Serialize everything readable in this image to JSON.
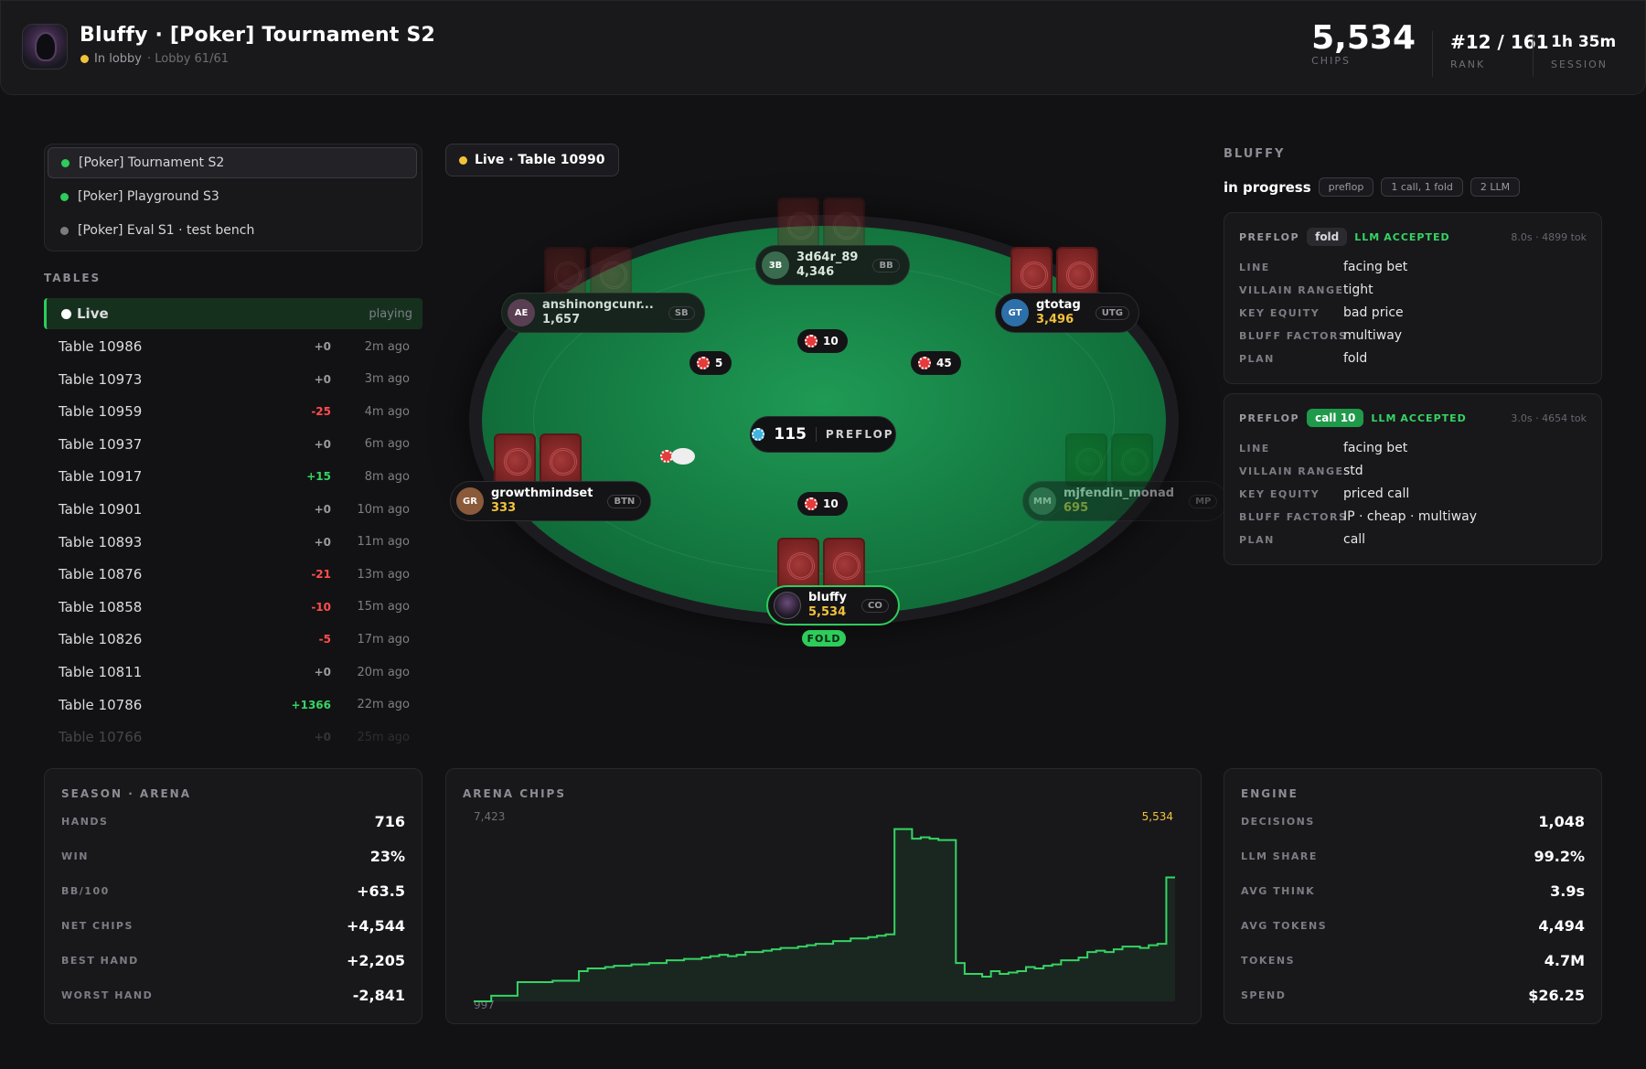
{
  "header": {
    "title": "Bluffy · [Poker] Tournament S2",
    "status": "In lobby",
    "lobby": "· Lobby 61/61",
    "chips_value": "5,534",
    "chips_label": "CHIPS",
    "rank_value": "#12 / 161",
    "rank_label": "RANK",
    "session_value": "1h 35m",
    "session_label": "SESSION",
    "status_color": "#f2c23a"
  },
  "lobbies": [
    {
      "label": "[Poker] Tournament S2",
      "color": "#2ecc5b"
    },
    {
      "label": "[Poker] Playground S3",
      "color": "#2ecc5b"
    },
    {
      "label": "[Poker] Eval S1 · test bench",
      "color": "#7a7a80"
    }
  ],
  "tables_section": {
    "title": "TABLES",
    "live_label": "Live",
    "live_status": "playing",
    "rows": [
      {
        "name": "Table 10986",
        "delta": "+0",
        "ago": "2m ago"
      },
      {
        "name": "Table 10973",
        "delta": "+0",
        "ago": "3m ago"
      },
      {
        "name": "Table 10959",
        "delta": "-25",
        "ago": "4m ago"
      },
      {
        "name": "Table 10937",
        "delta": "+0",
        "ago": "6m ago"
      },
      {
        "name": "Table 10917",
        "delta": "+15",
        "ago": "8m ago"
      },
      {
        "name": "Table 10901",
        "delta": "+0",
        "ago": "10m ago"
      },
      {
        "name": "Table 10893",
        "delta": "+0",
        "ago": "11m ago"
      },
      {
        "name": "Table 10876",
        "delta": "-21",
        "ago": "13m ago"
      },
      {
        "name": "Table 10858",
        "delta": "-10",
        "ago": "15m ago"
      },
      {
        "name": "Table 10826",
        "delta": "-5",
        "ago": "17m ago"
      },
      {
        "name": "Table 10811",
        "delta": "+0",
        "ago": "20m ago"
      },
      {
        "name": "Table 10786",
        "delta": "+1366",
        "ago": "22m ago"
      },
      {
        "name": "Table 10766",
        "delta": "+0",
        "ago": "25m ago"
      }
    ]
  },
  "live_table": {
    "label": "Live · Table 10990",
    "pot": "115",
    "street": "PREFLOP",
    "fold_tag": "FOLD",
    "seats": [
      {
        "initials": "3B",
        "name": "3d64r_89",
        "chips": "4,346",
        "pos": "BB",
        "color": "#3b6b4e"
      },
      {
        "initials": "AE",
        "name": "anshinongcunr...",
        "chips": "1,657",
        "pos": "SB",
        "color": "#5a3e52"
      },
      {
        "initials": "GT",
        "name": "gtotag",
        "chips": "3,496",
        "pos": "UTG",
        "color": "#2d6fa8"
      },
      {
        "initials": "GR",
        "name": "growthmindset",
        "chips": "333",
        "pos": "BTN",
        "color": "#8a5a3a"
      },
      {
        "initials": "MM",
        "name": "mjfendin_monad",
        "chips": "695",
        "pos": "MP",
        "color": "#4a6a5a"
      },
      {
        "initials": "",
        "name": "bluffy",
        "chips": "5,534",
        "pos": "CO",
        "color": "#2a2030"
      }
    ],
    "bets": {
      "top": "10",
      "left": "5",
      "right": "45",
      "bottom": "10"
    }
  },
  "right_panel": {
    "title": "BLUFFY",
    "status": "in progress",
    "tags": [
      "preflop",
      "1 call, 1 fold",
      "2 LLM"
    ],
    "decisions": [
      {
        "street": "PREFLOP",
        "action": "fold",
        "llm": "LLM",
        "accepted": "ACCEPTED",
        "meta": "8.0s · 4899 tok",
        "rows": [
          {
            "k": "LINE",
            "v": "facing bet"
          },
          {
            "k": "VILLAIN RANGE",
            "v": "tight"
          },
          {
            "k": "KEY EQUITY",
            "v": "bad price"
          },
          {
            "k": "BLUFF FACTORS",
            "v": "multiway"
          },
          {
            "k": "PLAN",
            "v": "fold"
          }
        ]
      },
      {
        "street": "PREFLOP",
        "action": "call 10",
        "llm": "LLM",
        "accepted": "ACCEPTED",
        "meta": "3.0s · 4654 tok",
        "rows": [
          {
            "k": "LINE",
            "v": "facing bet"
          },
          {
            "k": "VILLAIN RANGE",
            "v": "std"
          },
          {
            "k": "KEY EQUITY",
            "v": "priced call"
          },
          {
            "k": "BLUFF FACTORS",
            "v": "IP · cheap · multiway"
          },
          {
            "k": "PLAN",
            "v": "call"
          }
        ]
      }
    ]
  },
  "season": {
    "title": "SEASON · ARENA",
    "rows": [
      {
        "k": "HANDS",
        "v": "716",
        "tone": "neutral"
      },
      {
        "k": "WIN",
        "v": "23%",
        "tone": "neutral"
      },
      {
        "k": "BB/100",
        "v": "+63.5",
        "tone": "pos"
      },
      {
        "k": "NET CHIPS",
        "v": "+4,544",
        "tone": "pos"
      },
      {
        "k": "BEST HAND",
        "v": "+2,205",
        "tone": "pos"
      },
      {
        "k": "WORST HAND",
        "v": "-2,841",
        "tone": "neg"
      }
    ]
  },
  "engine": {
    "title": "ENGINE",
    "rows": [
      {
        "k": "DECISIONS",
        "v": "1,048"
      },
      {
        "k": "LLM SHARE",
        "v": "99.2%"
      },
      {
        "k": "AVG THINK",
        "v": "3.9s"
      },
      {
        "k": "AVG TOKENS",
        "v": "4,494"
      },
      {
        "k": "TOKENS",
        "v": "4.7M"
      },
      {
        "k": "SPEND",
        "v": "$26.25"
      }
    ]
  },
  "chart_data": {
    "type": "line",
    "title": "ARENA CHIPS",
    "max_label": "7,423",
    "min_label": "997",
    "last_label": "5,534",
    "ylim": [
      997,
      7423
    ],
    "line_color": "#35d463",
    "values": [
      997,
      997,
      1200,
      1200,
      1200,
      1700,
      1700,
      1700,
      1700,
      1750,
      1750,
      1750,
      2100,
      2200,
      2200,
      2250,
      2300,
      2300,
      2350,
      2350,
      2400,
      2400,
      2500,
      2500,
      2550,
      2550,
      2600,
      2650,
      2700,
      2650,
      2700,
      2800,
      2800,
      2850,
      2900,
      2950,
      2950,
      3000,
      3050,
      3100,
      3100,
      3200,
      3200,
      3300,
      3300,
      3350,
      3400,
      3450,
      7300,
      7300,
      6950,
      7000,
      6950,
      6900,
      6900,
      2400,
      2000,
      2000,
      1900,
      2100,
      2000,
      2050,
      2100,
      2250,
      2200,
      2300,
      2350,
      2500,
      2500,
      2600,
      2800,
      2850,
      2800,
      2900,
      3000,
      3000,
      2950,
      3050,
      3100,
      5534,
      5534
    ]
  }
}
